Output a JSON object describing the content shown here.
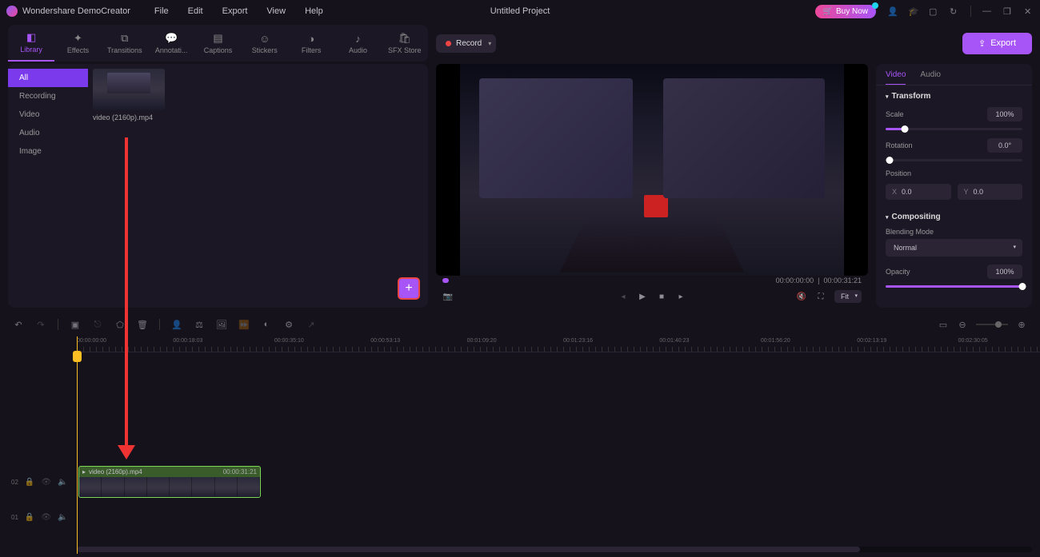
{
  "app": {
    "name": "Wondershare DemoCreator",
    "project_title": "Untitled Project"
  },
  "menu": [
    "File",
    "Edit",
    "Export",
    "View",
    "Help"
  ],
  "titlebar": {
    "buy_label": "Buy Now"
  },
  "toolbar": {
    "tabs": [
      {
        "label": "Library"
      },
      {
        "label": "Effects"
      },
      {
        "label": "Transitions"
      },
      {
        "label": "Annotati..."
      },
      {
        "label": "Captions"
      },
      {
        "label": "Stickers"
      },
      {
        "label": "Filters"
      },
      {
        "label": "Audio"
      },
      {
        "label": "SFX Store"
      }
    ],
    "record_label": "Record",
    "export_label": "Export"
  },
  "library": {
    "categories": [
      "All",
      "Recording",
      "Video",
      "Audio",
      "Image"
    ],
    "items": [
      {
        "name": "video (2160p).mp4"
      }
    ]
  },
  "preview": {
    "time_current": "00:00:00:00",
    "time_total": "00:00:31:21",
    "fit_label": "Fit"
  },
  "inspector": {
    "tabs": [
      "Video",
      "Audio"
    ],
    "transform_label": "Transform",
    "scale": {
      "label": "Scale",
      "value": "100%",
      "pct": 14
    },
    "rotation": {
      "label": "Rotation",
      "value": "0.0°",
      "pct": 3
    },
    "position": {
      "label": "Position",
      "x": "0.0",
      "y": "0.0"
    },
    "compositing_label": "Compositing",
    "blend": {
      "label": "Blending Mode",
      "value": "Normal"
    },
    "opacity": {
      "label": "Opacity",
      "value": "100%",
      "pct": 100
    }
  },
  "timeline": {
    "marks": [
      "00:00:00:00",
      "00:00:18:03",
      "00:00:35:10",
      "00:00:53:13",
      "00:01:09:20",
      "00:01:23:16",
      "00:01:40:23",
      "00:01:56:20",
      "00:02:13:19",
      "00:02:30:05"
    ],
    "tracks": [
      {
        "id": "02"
      },
      {
        "id": "01"
      }
    ],
    "clip": {
      "name": "video (2160p).mp4",
      "duration": "00:00:31:21"
    }
  }
}
